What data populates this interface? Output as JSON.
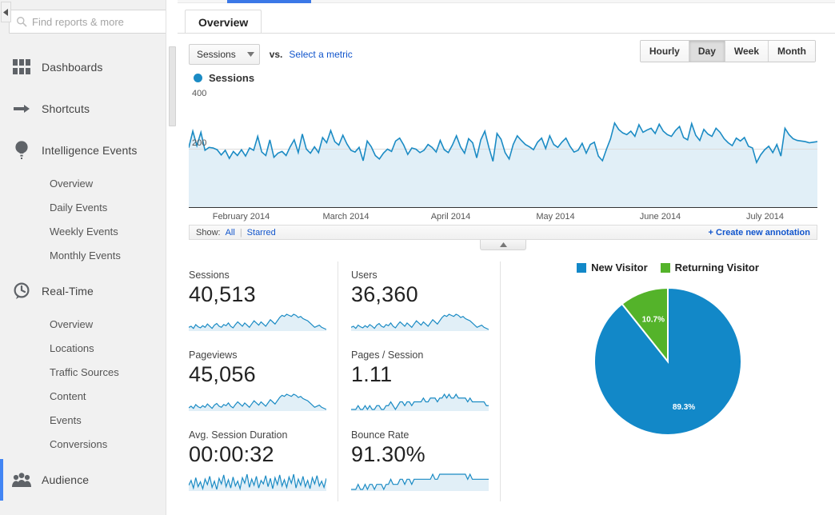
{
  "sidebar": {
    "search": {
      "placeholder": "Find reports & more",
      "value": ""
    },
    "groups": [
      {
        "icon": "dashboards-icon",
        "label": "Dashboards",
        "active": false,
        "children": []
      },
      {
        "icon": "shortcuts-icon",
        "label": "Shortcuts",
        "active": false,
        "children": []
      },
      {
        "icon": "intelligence-icon",
        "label": "Intelligence Events",
        "active": false,
        "children": [
          "Overview",
          "Daily Events",
          "Weekly Events",
          "Monthly Events"
        ]
      },
      {
        "icon": "realtime-icon",
        "label": "Real-Time",
        "active": false,
        "children": [
          "Overview",
          "Locations",
          "Traffic Sources",
          "Content",
          "Events",
          "Conversions"
        ]
      },
      {
        "icon": "audience-icon",
        "label": "Audience",
        "active": true,
        "children": []
      }
    ],
    "collapse_icon": "collapse-left-icon"
  },
  "main": {
    "tab": {
      "label": "Overview"
    },
    "controls": {
      "metric_select": "Sessions",
      "vs_label": "vs.",
      "select_metric_link": "Select a metric",
      "granularity": [
        "Hourly",
        "Day",
        "Week",
        "Month"
      ],
      "granularity_active": "Day"
    },
    "annotations": {
      "show_label": "Show:",
      "all_label": "All",
      "separator": "|",
      "starred_label": "Starred",
      "create_label": "+ Create new annotation"
    }
  },
  "chart_data": {
    "type": "area",
    "title": "Sessions",
    "legend": [
      "Sessions"
    ],
    "legend_position": "top-left",
    "series_color": "#1b8bc4",
    "fill_color": "#e1eff7",
    "xlabel": "",
    "ylabel": "",
    "ylim": [
      0,
      400
    ],
    "yticks": [
      200,
      400
    ],
    "ytick_labels": [
      "200",
      "400"
    ],
    "xtick_labels": [
      "February 2014",
      "March 2014",
      "April 2014",
      "May 2014",
      "June 2014",
      "July 2014"
    ],
    "grid": false,
    "values": [
      205,
      262,
      212,
      258,
      196,
      206,
      204,
      198,
      180,
      196,
      168,
      192,
      178,
      198,
      176,
      204,
      196,
      244,
      190,
      178,
      232,
      172,
      186,
      192,
      178,
      208,
      232,
      188,
      252,
      200,
      186,
      208,
      188,
      240,
      222,
      264,
      226,
      214,
      248,
      218,
      196,
      190,
      206,
      160,
      228,
      208,
      178,
      166,
      186,
      200,
      192,
      228,
      238,
      214,
      182,
      204,
      200,
      188,
      196,
      216,
      206,
      190,
      230,
      198,
      188,
      214,
      246,
      208,
      186,
      236,
      222,
      170,
      232,
      262,
      206,
      158,
      254,
      234,
      188,
      166,
      216,
      246,
      230,
      216,
      208,
      198,
      224,
      238,
      202,
      246,
      216,
      206,
      224,
      238,
      210,
      190,
      196,
      220,
      186,
      216,
      224,
      176,
      160,
      200,
      236,
      290,
      268,
      256,
      250,
      262,
      244,
      284,
      258,
      266,
      272,
      254,
      286,
      262,
      250,
      244,
      264,
      278,
      240,
      232,
      288,
      248,
      230,
      268,
      252,
      244,
      272,
      258,
      236,
      222,
      212,
      238,
      228,
      240,
      210,
      204,
      154,
      180,
      198,
      210,
      188,
      216,
      176,
      272,
      250,
      236,
      230,
      228,
      226,
      222,
      224,
      226
    ]
  },
  "metrics": [
    [
      {
        "title": "Sessions",
        "value": "40,513",
        "spark": [
          50,
          52,
          48,
          55,
          51,
          49,
          53,
          50,
          56,
          52,
          48,
          54,
          57,
          52,
          50,
          55,
          53,
          58,
          52,
          49,
          55,
          60,
          56,
          52,
          58,
          54,
          50,
          56,
          62,
          58,
          54,
          60,
          56,
          52,
          58,
          64,
          60,
          56,
          62,
          68,
          72,
          70,
          74,
          72,
          70,
          74,
          72,
          68,
          70,
          66,
          64,
          62,
          58,
          54,
          50,
          52,
          54,
          50,
          48,
          46
        ]
      },
      {
        "title": "Users",
        "value": "36,360",
        "spark": [
          48,
          50,
          46,
          52,
          49,
          47,
          51,
          48,
          53,
          50,
          46,
          52,
          55,
          50,
          48,
          53,
          51,
          56,
          50,
          47,
          53,
          58,
          54,
          50,
          56,
          52,
          48,
          54,
          60,
          56,
          52,
          58,
          54,
          50,
          56,
          62,
          58,
          54,
          60,
          66,
          70,
          68,
          72,
          70,
          68,
          72,
          70,
          66,
          68,
          64,
          62,
          60,
          56,
          52,
          48,
          50,
          52,
          48,
          46,
          44
        ]
      }
    ],
    [
      {
        "title": "Pageviews",
        "value": "45,056",
        "spark": [
          50,
          53,
          49,
          56,
          52,
          50,
          54,
          51,
          57,
          53,
          49,
          55,
          58,
          53,
          51,
          56,
          54,
          59,
          53,
          50,
          56,
          61,
          57,
          53,
          59,
          55,
          51,
          57,
          63,
          59,
          55,
          61,
          57,
          53,
          59,
          65,
          61,
          57,
          63,
          69,
          73,
          71,
          75,
          73,
          71,
          75,
          73,
          69,
          71,
          67,
          65,
          63,
          59,
          55,
          51,
          53,
          55,
          51,
          49,
          47
        ]
      },
      {
        "title": "Pages / Session",
        "value": "1.11",
        "spark": [
          60,
          60,
          60,
          61,
          60,
          60,
          61,
          60,
          61,
          60,
          60,
          61,
          61,
          60,
          60,
          61,
          61,
          62,
          61,
          60,
          61,
          62,
          62,
          61,
          62,
          62,
          61,
          62,
          62,
          62,
          62,
          63,
          62,
          62,
          63,
          63,
          63,
          62,
          63,
          63,
          64,
          63,
          64,
          63,
          63,
          64,
          63,
          63,
          63,
          63,
          62,
          63,
          62,
          62,
          62,
          62,
          62,
          62,
          61,
          61
        ]
      }
    ],
    [
      {
        "title": "Avg. Session Duration",
        "value": "00:00:32",
        "spark": [
          48,
          62,
          40,
          70,
          44,
          58,
          38,
          66,
          50,
          74,
          42,
          60,
          36,
          68,
          52,
          78,
          44,
          64,
          40,
          72,
          46,
          60,
          38,
          70,
          54,
          80,
          42,
          66,
          48,
          74,
          40,
          62,
          52,
          76,
          44,
          68,
          38,
          70,
          50,
          78,
          46,
          64,
          42,
          72,
          54,
          80,
          40,
          66,
          48,
          74,
          44,
          62,
          38,
          70,
          52,
          76,
          46,
          60,
          42,
          68
        ]
      },
      {
        "title": "Bounce Rate",
        "value": "91.30%",
        "spark": [
          64,
          64,
          64,
          65,
          64,
          64,
          65,
          64,
          65,
          65,
          64,
          65,
          65,
          65,
          64,
          65,
          65,
          66,
          65,
          65,
          65,
          66,
          66,
          65,
          66,
          66,
          65,
          66,
          66,
          66,
          66,
          66,
          66,
          66,
          66,
          67,
          66,
          66,
          67,
          67,
          67,
          67,
          67,
          67,
          67,
          67,
          67,
          67,
          67,
          67,
          66,
          67,
          66,
          66,
          66,
          66,
          66,
          66,
          66,
          66
        ]
      }
    ]
  ],
  "pie_chart": {
    "type": "pie",
    "title": "",
    "legend": [
      "New Visitor",
      "Returning Visitor"
    ],
    "legend_position": "top",
    "labels": [
      "New Visitor",
      "Returning Visitor"
    ],
    "values": [
      89.3,
      10.7
    ],
    "value_labels": [
      "89.3%",
      "10.7%"
    ],
    "colors": [
      "#1288c8",
      "#54b32a"
    ]
  },
  "colors": {
    "accent_blue": "#1b8bc4",
    "tab_indicator": "#3b78e7",
    "link": "#1155cc",
    "sidebar_bg": "#f1f1f1",
    "active_marker": "#4285f4"
  }
}
